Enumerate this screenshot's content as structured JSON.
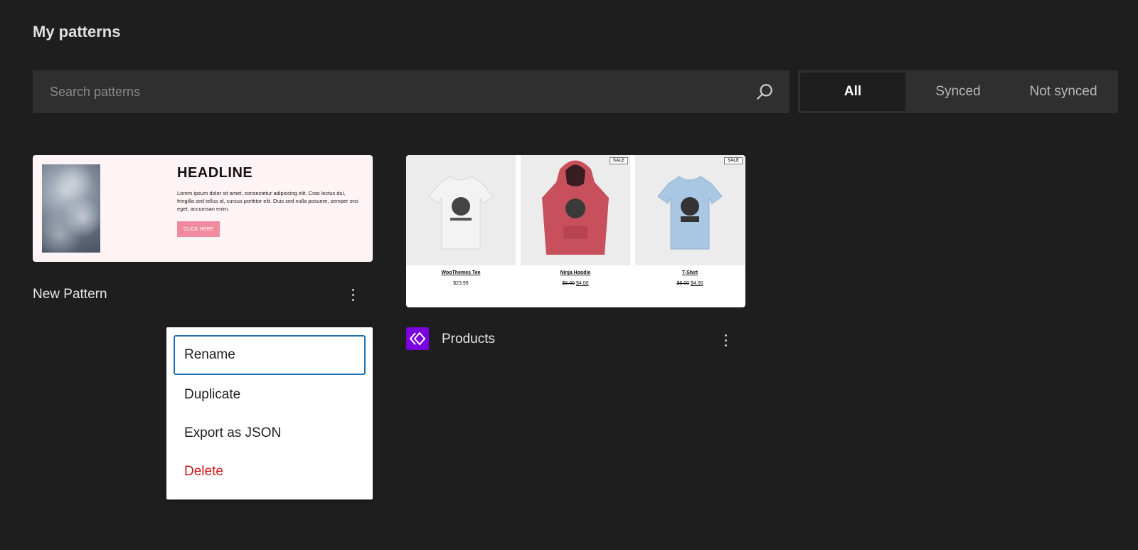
{
  "page": {
    "title": "My patterns"
  },
  "search": {
    "placeholder": "Search patterns",
    "value": ""
  },
  "filter": {
    "options": [
      "All",
      "Synced",
      "Not synced"
    ],
    "selected": "All"
  },
  "patterns": [
    {
      "title": "New Pattern",
      "preview": {
        "headline": "HEADLINE",
        "body": "Lorem ipsum dolor sit amet, consectetur adipiscing elit. Cras lectus dui, fringilla sed tellus id, cursus porttitor elit. Duis sed nulla posuere, semper orci eget, accumsan enim.",
        "button": "CLICK HERE",
        "button_color": "#f08aa0",
        "background_color": "#fff4f5"
      },
      "synced": false
    },
    {
      "title": "Products",
      "synced": true,
      "badge_color": "#7a00df",
      "preview": {
        "products": [
          {
            "name": "WooThemes Tee",
            "price": "$23.99",
            "old_price": "",
            "sale": "",
            "color": "#e9e9e9"
          },
          {
            "name": "Ninja Hoodie",
            "price": "$4.00",
            "old_price": "$6.00",
            "sale": "SALE",
            "color": "#c8505c"
          },
          {
            "name": "T-Shirt",
            "price": "$4.00",
            "old_price": "$6.00",
            "sale": "SALE",
            "color": "#a9c7e3"
          }
        ]
      }
    }
  ],
  "context_menu": {
    "items": [
      {
        "label": "Rename",
        "focused": true,
        "danger": false
      },
      {
        "label": "Duplicate",
        "focused": false,
        "danger": false
      },
      {
        "label": "Export as JSON",
        "focused": false,
        "danger": false
      },
      {
        "label": "Delete",
        "focused": false,
        "danger": true
      }
    ]
  }
}
